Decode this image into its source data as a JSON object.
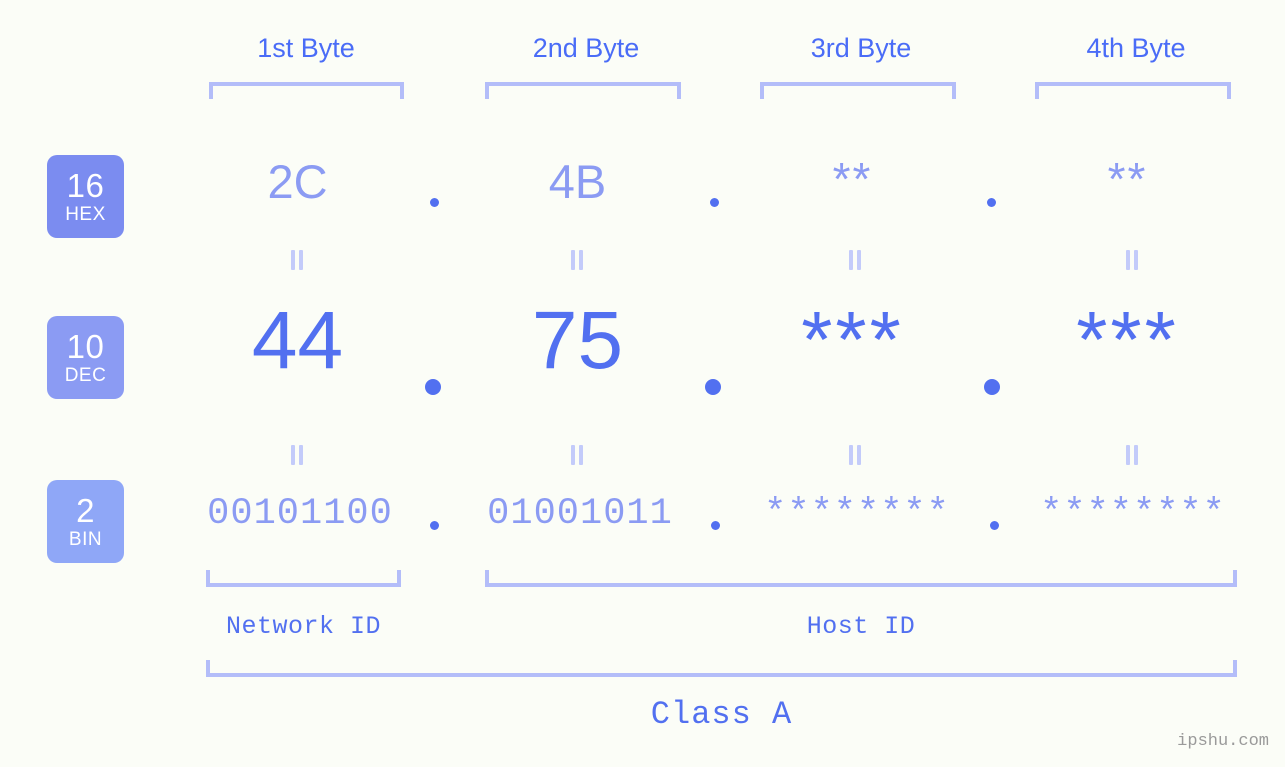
{
  "colors": {
    "background": "#fbfdf7",
    "accent_strong": "#4a6cf7",
    "accent_value": "#5270f0",
    "accent_light": "#8b9bf3",
    "bracket": "#b3bdf9",
    "equals": "#c3cbfa",
    "badge_hex": "#7b8cf0",
    "badge_dec": "#8b9bf3",
    "badge_bin": "#8fa7f7",
    "watermark": "#9a9a9a"
  },
  "header": {
    "bytes": [
      {
        "label": "1st Byte"
      },
      {
        "label": "2nd Byte"
      },
      {
        "label": "3rd Byte"
      },
      {
        "label": "4th Byte"
      }
    ]
  },
  "rows": {
    "hex": {
      "badge_number": "16",
      "badge_system": "HEX",
      "values": [
        "2C",
        "4B",
        "**",
        "**"
      ],
      "separators": [
        ".",
        ".",
        "."
      ]
    },
    "dec": {
      "badge_number": "10",
      "badge_system": "DEC",
      "values": [
        "44",
        "75",
        "***",
        "***"
      ],
      "separators": [
        ".",
        ".",
        "."
      ]
    },
    "bin": {
      "badge_number": "2",
      "badge_system": "BIN",
      "values": [
        "00101100",
        "01001011",
        "********",
        "********"
      ],
      "separators": [
        ".",
        ".",
        "."
      ]
    }
  },
  "footer": {
    "network_id_label": "Network ID",
    "host_id_label": "Host ID",
    "class_label": "Class A"
  },
  "watermark": "ipshu.com"
}
